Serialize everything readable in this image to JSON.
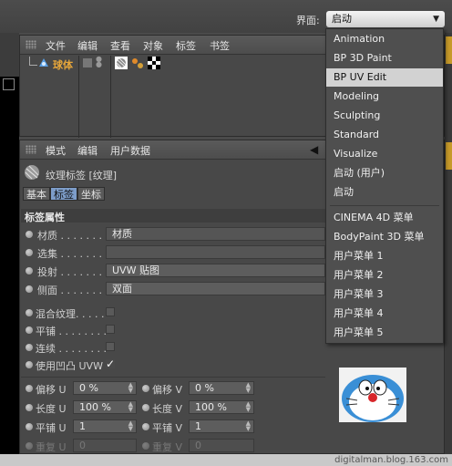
{
  "top": {
    "layout_label": "界面:",
    "layout_value": "启动"
  },
  "obj_manager": {
    "menu": [
      "文件",
      "编辑",
      "查看",
      "对象",
      "标签",
      "书签"
    ],
    "object_name": "球体"
  },
  "attr_manager": {
    "menu": [
      "模式",
      "编辑",
      "用户数据"
    ],
    "tag_title": "纹理标签 [纹理]",
    "tabs": [
      "基本",
      "标签",
      "坐标"
    ],
    "active_tab": "标签",
    "section_title": "标签属性",
    "rows": [
      {
        "label": "材质",
        "dots": ". . . . . . . .",
        "value": "材质"
      },
      {
        "label": "选集",
        "dots": ". . . . . . . .",
        "value": ""
      },
      {
        "label": "投射",
        "dots": ". . . . . . . .",
        "value": "UVW 贴图"
      },
      {
        "label": "侧面",
        "dots": ". . . . . . . .",
        "value": "双面"
      }
    ],
    "checks": [
      {
        "label": "混合纹理",
        "dots": ". . . . .",
        "checked": false
      },
      {
        "label": "平铺",
        "dots": ". . . . . . . .",
        "checked": false
      },
      {
        "label": "连续",
        "dots": ". . . . . . . .",
        "checked": false
      },
      {
        "label": "使用凹凸 UVW",
        "dots": "",
        "checked": true
      }
    ],
    "check_mark": "✓",
    "params": [
      {
        "l1": "偏移 U",
        "v1": "0 %",
        "l2": "偏移 V",
        "v2": "0 %"
      },
      {
        "l1": "长度 U",
        "v1": "100 %",
        "l2": "长度 V",
        "v2": "100 %"
      },
      {
        "l1": "平铺 U",
        "v1": "1",
        "l2": "平铺 V",
        "v2": "1"
      },
      {
        "l1": "重复 U",
        "v1": "0",
        "l2": "重复 V",
        "v2": "0"
      }
    ]
  },
  "dropdown": {
    "items": [
      "Animation",
      "BP 3D Paint",
      "BP UV Edit",
      "Modeling",
      "Sculpting",
      "Standard",
      "Visualize",
      "启动 (用户)",
      "启动"
    ],
    "selected": "BP UV Edit",
    "user_items": [
      "CINEMA 4D 菜单",
      "BodyPaint 3D 菜单",
      "用户菜单 1",
      "用户菜单 2",
      "用户菜单 3",
      "用户菜单 4",
      "用户菜单 5"
    ]
  },
  "footer": {
    "watermark": "digitalman.blog.163.com"
  },
  "colors": {
    "object_name": "#e8a73a",
    "selected_bg": "#d2d2d2"
  }
}
